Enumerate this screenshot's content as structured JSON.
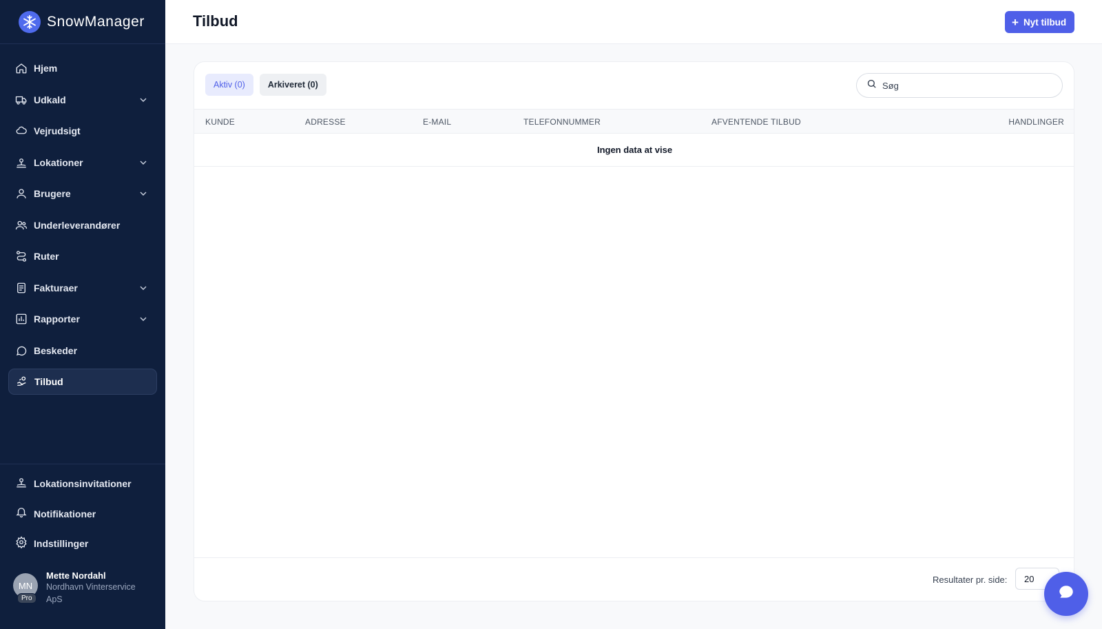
{
  "app": {
    "name": "SnowManager"
  },
  "sidebar": {
    "items": [
      {
        "label": "Hjem",
        "icon": "home-icon",
        "has_chevron": false
      },
      {
        "label": "Udkald",
        "icon": "truck-icon",
        "has_chevron": true
      },
      {
        "label": "Vejrudsigt",
        "icon": "cloud-icon",
        "has_chevron": false
      },
      {
        "label": "Lokationer",
        "icon": "location-pin-icon",
        "has_chevron": true
      },
      {
        "label": "Brugere",
        "icon": "user-icon",
        "has_chevron": true
      },
      {
        "label": "Underleverandører",
        "icon": "users-icon",
        "has_chevron": false
      },
      {
        "label": "Ruter",
        "icon": "route-icon",
        "has_chevron": false
      },
      {
        "label": "Fakturaer",
        "icon": "invoice-icon",
        "has_chevron": true
      },
      {
        "label": "Rapporter",
        "icon": "bar-chart-icon",
        "has_chevron": true
      },
      {
        "label": "Beskeder",
        "icon": "message-icon",
        "has_chevron": false
      },
      {
        "label": "Tilbud",
        "icon": "offer-icon",
        "has_chevron": false,
        "active": true
      }
    ],
    "bottom_items": [
      {
        "label": "Lokationsinvitationer",
        "icon": "location-pin-icon"
      },
      {
        "label": "Notifikationer",
        "icon": "bell-icon"
      },
      {
        "label": "Indstillinger",
        "icon": "gear-icon"
      }
    ],
    "user": {
      "initials": "MN",
      "badge": "Pro",
      "name": "Mette Nordahl",
      "org": "Nordhavn Vinterservice ApS"
    }
  },
  "header": {
    "title": "Tilbud",
    "new_button_label": "Nyt tilbud"
  },
  "tabs": [
    {
      "label": "Aktiv (0)",
      "active": true
    },
    {
      "label": "Arkiveret (0)",
      "active": false
    }
  ],
  "search": {
    "placeholder": "Søg",
    "value": ""
  },
  "table": {
    "columns": [
      "KUNDE",
      "ADRESSE",
      "E-MAIL",
      "TELEFONNUMMER",
      "AFVENTENDE TILBUD",
      "HANDLINGER"
    ],
    "empty_text": "Ingen data at vise"
  },
  "pagination": {
    "per_page_label": "Resultater pr. side:",
    "per_page_value": "20"
  },
  "colors": {
    "sidebar_bg": "#0f1f3d",
    "accent": "#4f5fe8",
    "active_tab_bg": "#e8ebfd"
  }
}
